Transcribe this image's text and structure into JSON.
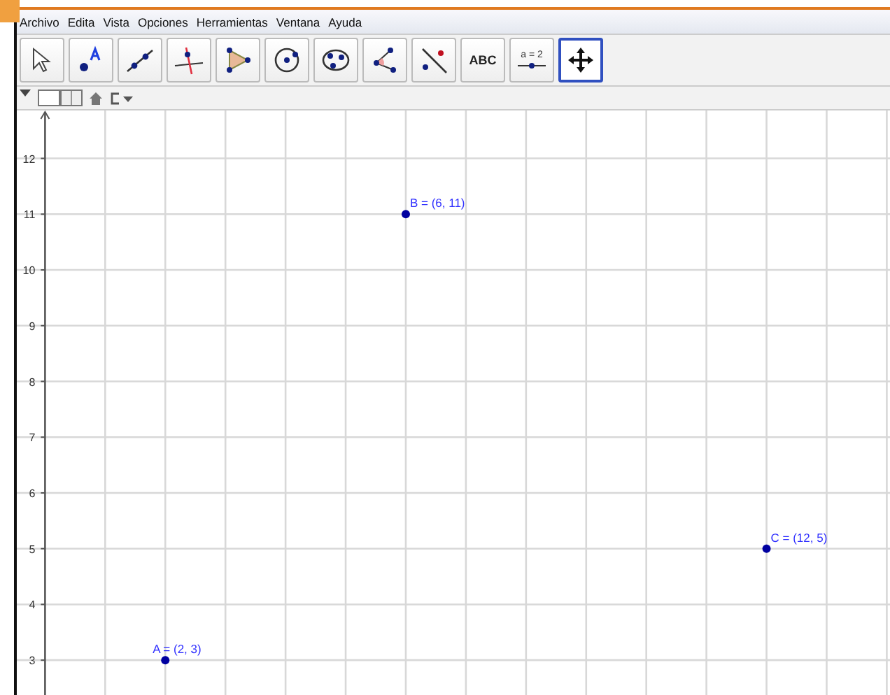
{
  "menu": [
    "Archivo",
    "Edita",
    "Vista",
    "Opciones",
    "Herramientas",
    "Ventana",
    "Ayuda"
  ],
  "tools": [
    {
      "kind": "pointer",
      "selected": false
    },
    {
      "kind": "point",
      "selected": false
    },
    {
      "kind": "line",
      "selected": false
    },
    {
      "kind": "perpendicular",
      "selected": false
    },
    {
      "kind": "polygon",
      "selected": false
    },
    {
      "kind": "circle",
      "selected": false
    },
    {
      "kind": "conic",
      "selected": false
    },
    {
      "kind": "angle",
      "selected": false
    },
    {
      "kind": "reflect",
      "selected": false
    },
    {
      "kind": "text",
      "label": "ABC",
      "selected": false
    },
    {
      "kind": "slider",
      "label": "a = 2",
      "selected": false
    },
    {
      "kind": "pan",
      "selected": true
    }
  ],
  "graphics": {
    "y_axis_labels": [
      "12",
      "11",
      "10",
      "9",
      "8",
      "7",
      "6",
      "5",
      "4",
      "3"
    ],
    "points": [
      {
        "label": "A = (2, 3)",
        "color": "#0000a0"
      },
      {
        "label": "B = (6, 11)",
        "color": "#0000a0"
      },
      {
        "label": "C = (12, 5)",
        "color": "#0000a0"
      }
    ]
  }
}
